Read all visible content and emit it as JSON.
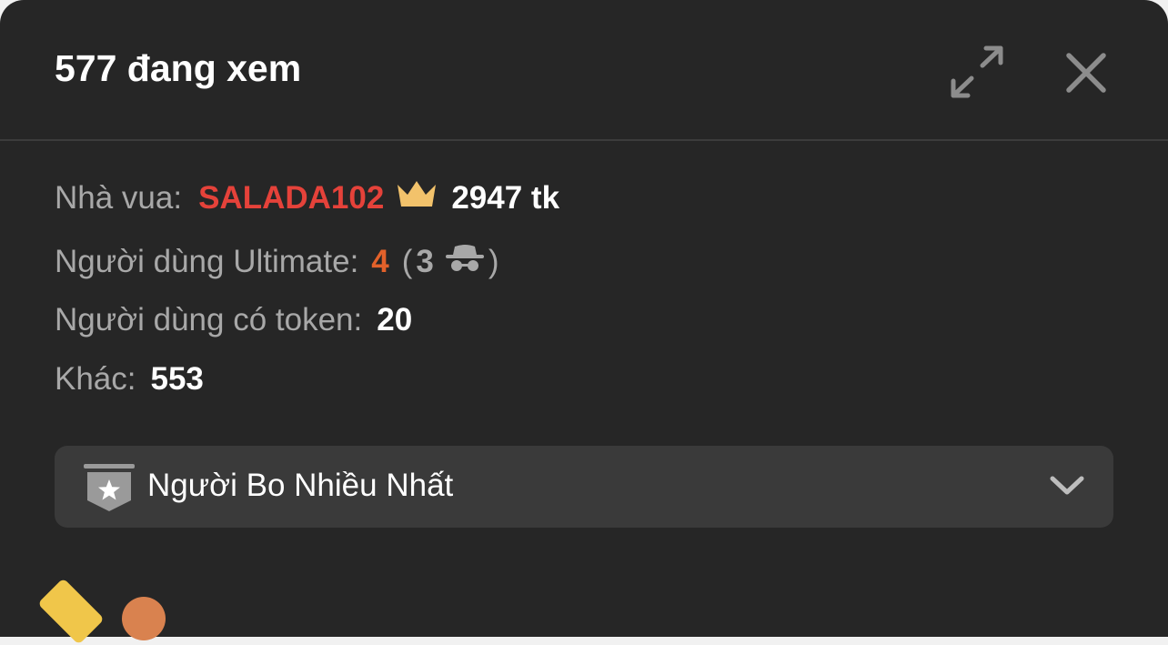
{
  "header": {
    "title": "577 đang xem",
    "expand_icon": "expand-icon",
    "close_icon": "close-icon"
  },
  "stats": {
    "king_label": "Nhà vua:",
    "king_name": "SALADA102",
    "king_icon": "crown-icon",
    "king_tokens": "2947 tk",
    "ultimate_label": "Người dùng Ultimate:",
    "ultimate_count": "4",
    "ultimate_open_paren": "(",
    "ultimate_hidden_count": "3",
    "ultimate_hidden_icon": "incognito-icon",
    "ultimate_close_paren": ")",
    "token_users_label": "Người dùng có token:",
    "token_users_count": "20",
    "others_label": "Khác:",
    "others_count": "553"
  },
  "dropdown": {
    "label": "Người Bo Nhiều Nhất",
    "icon": "star-badge-icon",
    "chevron": "chevron-down-icon"
  },
  "colors": {
    "panel_bg": "#262626",
    "king_name": "#e5423a",
    "ultimate_count": "#e2612a",
    "crown": "#f2c26b",
    "muted_text": "#a8a8a8",
    "dropdown_bg": "#3a3a3a"
  }
}
